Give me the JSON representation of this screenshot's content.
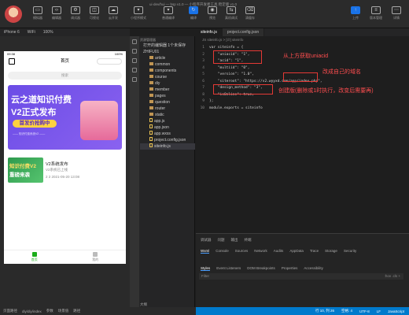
{
  "window": {
    "title": "ui·dev/hui — bsp v1.0 — 小程序开发者工具 稳定版 v1.0"
  },
  "toolbar": {
    "left": [
      {
        "icon": "simulator-icon",
        "label": "模拟器"
      },
      {
        "icon": "editor-icon",
        "label": "编辑器"
      },
      {
        "icon": "debugger-icon",
        "label": "调试器"
      },
      {
        "icon": "visual-icon",
        "label": "可视化"
      },
      {
        "icon": "cloud-icon",
        "label": "云开发"
      }
    ],
    "mode": {
      "label": "小程序模式"
    },
    "compile": {
      "label": "普通编译"
    },
    "mid": [
      {
        "icon": "compile-icon",
        "label": "编译"
      },
      {
        "icon": "preview-icon",
        "label": "预览"
      },
      {
        "icon": "remote-debug-icon",
        "label": "真机调试"
      },
      {
        "icon": "clear-cache-icon",
        "label": "清缓存"
      }
    ],
    "right": [
      {
        "icon": "upload-icon",
        "label": "上传"
      },
      {
        "icon": "version-icon",
        "label": "版本管理"
      },
      {
        "icon": "details-icon",
        "label": "详情"
      }
    ]
  },
  "device_bar": {
    "device": "iPhone 6",
    "network": "WiFi",
    "zoom": "100%"
  },
  "editor_tabs": [
    {
      "label": "siteinfo.js",
      "active": true
    },
    {
      "label": "project.config.json",
      "active": false
    }
  ],
  "phone": {
    "time": "09:38",
    "battery": "100%",
    "nav_title": "首页",
    "search_placeholder": "搜索",
    "banner": {
      "title_line1": "云之道知识付费",
      "title_line2": "V2正式发布",
      "button": "首发价抢购中",
      "sub": "—— 知识付费系统V2 ——"
    },
    "card": {
      "img_line1": "知识付费V2",
      "img_line2": "重磅来袭",
      "title": "V2系统发布",
      "desc": "V2系统已上线",
      "meta": "2 2  2021-05-20 13:08"
    },
    "tabbar": [
      {
        "label": "首页",
        "active": true
      },
      {
        "label": "我的",
        "active": false
      }
    ]
  },
  "explorer": {
    "header": "资源管理器",
    "open_editors": "打开的编辑器",
    "open_badge": "1个未保存",
    "project": "ZHIFU01",
    "folders": [
      "article",
      "common",
      "components",
      "course",
      "diy",
      "member",
      "pages",
      "question",
      "router",
      "static"
    ],
    "files": [
      "app.js",
      "app.json",
      "app.wxss",
      "project.config.json",
      "siteinfo.js"
    ],
    "selected": "siteinfo.js",
    "outline": "大纲"
  },
  "editor": {
    "breadcrumb": "JS siteinfo.js > [∅] siteinfo",
    "lines": [
      {
        "n": "1",
        "text": "var siteinfo = {"
      },
      {
        "n": "2",
        "text": "    \"uniacid\": \"1\","
      },
      {
        "n": "3",
        "text": "    \"acid\": \"1\","
      },
      {
        "n": "4",
        "text": "    \"multiid\": \"0\","
      },
      {
        "n": "5",
        "text": "    \"version\": \"1.0\","
      },
      {
        "n": "6",
        "text": "    \"siteroot\": \"https://v2.wyyxd.com/app/index.php\","
      },
      {
        "n": "7",
        "text": "    \"design_method\": \"3\","
      },
      {
        "n": "8",
        "text": "    \"isOnline\": true,"
      },
      {
        "n": "9",
        "text": "};"
      },
      {
        "n": "10",
        "text": "module.exports = siteinfo"
      }
    ],
    "annotations": {
      "a1": "从上方获取uniacid",
      "a2": "改成自己的域名",
      "a3": "创建版(删除或1时执行，改变后需要再)"
    }
  },
  "devtools": {
    "tabs_top": [
      "调试器",
      "问题",
      "输出",
      "终端"
    ],
    "tabs": [
      "Wxml",
      "Console",
      "Sources",
      "Network",
      "Audits",
      "AppData",
      "Trace",
      "Storage",
      "Security"
    ],
    "active_tab": "Wxml",
    "subtabs": [
      "Styles",
      "Event Listeners",
      "DOM Breakpoints",
      "Properties",
      "Accessibility"
    ],
    "filter_placeholder": "Filter",
    "filter_right": ":hov  .cls  +"
  },
  "status_bar": {
    "left": [
      "页面路径",
      "diy/diy/index",
      "参数",
      "场景值",
      "路径"
    ],
    "right": [
      "行 10, 列 26",
      "空格: 4",
      "UTF-8",
      "LF",
      "JavaScript"
    ]
  }
}
